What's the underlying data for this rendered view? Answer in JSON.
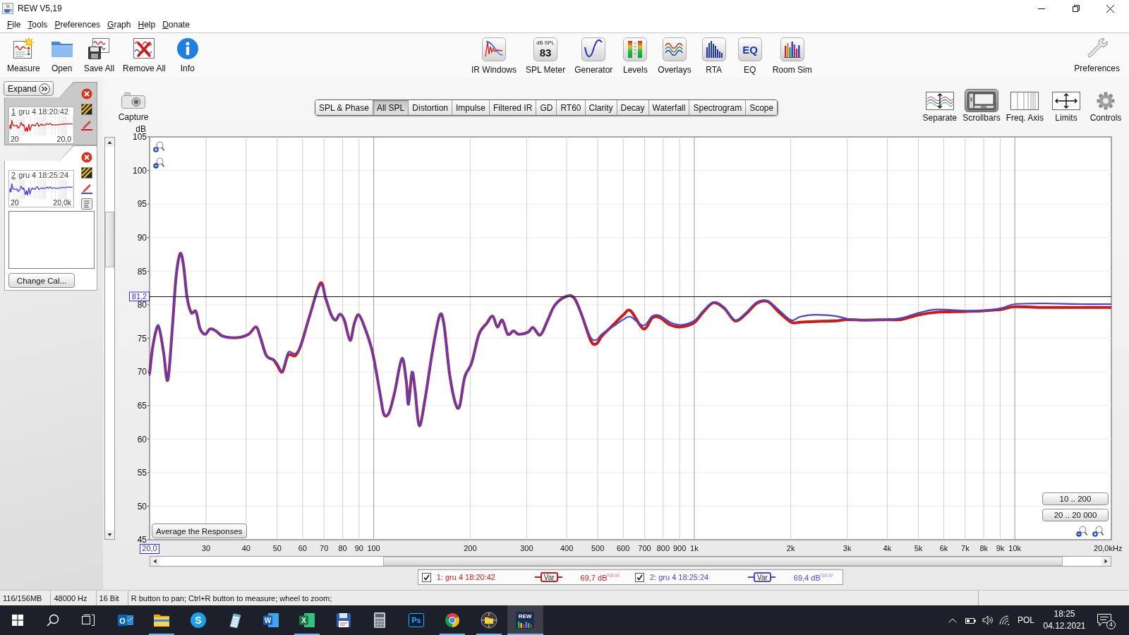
{
  "window": {
    "title": "REW V5,19"
  },
  "menu": [
    "File",
    "Tools",
    "Preferences",
    "Graph",
    "Help",
    "Donate"
  ],
  "toolbar": {
    "left": [
      {
        "kind": "measure",
        "label": "Measure"
      },
      {
        "kind": "open",
        "label": "Open"
      },
      {
        "kind": "saveall",
        "label": "Save All"
      },
      {
        "kind": "removeall",
        "label": "Remove All"
      },
      {
        "kind": "info",
        "label": "Info"
      }
    ],
    "center": [
      {
        "kind": "irwindows",
        "label": "IR Windows"
      },
      {
        "kind": "meter",
        "label": "SPL Meter",
        "icon_unit": "dB SPL",
        "icon_value": "83"
      },
      {
        "kind": "generator",
        "label": "Generator"
      },
      {
        "kind": "levels",
        "label": "Levels"
      },
      {
        "kind": "overlays",
        "label": "Overlays"
      },
      {
        "kind": "rta",
        "label": "RTA"
      },
      {
        "kind": "eq",
        "label": "EQ",
        "icon_text": "EQ"
      },
      {
        "kind": "roomsim",
        "label": "Room Sim"
      }
    ],
    "right": [
      {
        "kind": "preferences",
        "label": "Preferences"
      }
    ]
  },
  "side_panel": {
    "expand_label": "Expand",
    "measurements": [
      {
        "number": "1",
        "name": "gru 4 18:20:42",
        "axis_start": "20",
        "axis_end": "20,0",
        "color": "#cc2020",
        "selected": false
      },
      {
        "number": "2",
        "name": "gru 4 18:25:24",
        "axis_start": "20",
        "axis_end": "20,0k",
        "color": "#4848d8",
        "selected": true
      }
    ],
    "change_cal_label": "Change Cal..."
  },
  "capture_label": "Capture",
  "graph_tabs": [
    {
      "label": "SPL & Phase",
      "selected": false
    },
    {
      "label": "All SPL",
      "selected": true
    },
    {
      "label": "Distortion",
      "selected": false
    },
    {
      "label": "Impulse",
      "selected": false
    },
    {
      "label": "Filtered IR",
      "selected": false
    },
    {
      "label": "GD",
      "selected": false
    },
    {
      "label": "RT60",
      "selected": false
    },
    {
      "label": "Clarity",
      "selected": false
    },
    {
      "label": "Decay",
      "selected": false
    },
    {
      "label": "Waterfall",
      "selected": false
    },
    {
      "label": "Spectrogram",
      "selected": false
    },
    {
      "label": "Scope",
      "selected": false
    }
  ],
  "view_buttons": [
    {
      "kind": "separate",
      "label": "Separate",
      "selected": false
    },
    {
      "kind": "scrollbars",
      "label": "Scrollbars",
      "selected": true
    },
    {
      "kind": "freqaxis",
      "label": "Freq. Axis",
      "selected": false
    },
    {
      "kind": "limits",
      "label": "Limits",
      "selected": false
    },
    {
      "kind": "controls",
      "label": "Controls",
      "selected": false
    }
  ],
  "graph": {
    "chart_data": {
      "type": "line",
      "xlabel": "Hz",
      "ylabel": "dB",
      "log": "x",
      "grid": true,
      "x": [
        20,
        20.5,
        21.3,
        22.1,
        22.8,
        23.6,
        24.2,
        24.9,
        25.5,
        26.2,
        27,
        27.9,
        28.7,
        29.8,
        30.9,
        32.2,
        33.9,
        37.6,
        40.7,
        43,
        44.4,
        46.3,
        48.7,
        50,
        51.9,
        54.1,
        56.9,
        59.3,
        63.1,
        68.2,
        70.8,
        73.7,
        76.1,
        78.5,
        81,
        84.4,
        87,
        89.8,
        93.6,
        98.6,
        101.7,
        104.9,
        107.6,
        111.6,
        116.3,
        122.5,
        126.4,
        128.4,
        131.7,
        134.5,
        138.7,
        144.6,
        152.3,
        160.4,
        165.5,
        172.5,
        179.7,
        185.4,
        192.2,
        202,
        213,
        225,
        235,
        243,
        252,
        262,
        273,
        283,
        303,
        314,
        331,
        349,
        367,
        397,
        422,
        447,
        476,
        496,
        514,
        556,
        601,
        633,
        694,
        739,
        778,
        841,
        909,
        998,
        1062,
        1147,
        1240,
        1340,
        1448,
        1566,
        1692,
        1828,
        2007,
        2136,
        2369,
        2767,
        3006,
        3404,
        3996,
        4410,
        5018,
        5712,
        7028,
        7998,
        9102,
        9991,
        12426,
        16092,
        20000
      ],
      "series": [
        {
          "color": "#cc1a1a",
          "values": [
            69.7,
            74.0,
            76.8,
            73.0,
            68.8,
            77.2,
            84.2,
            87.6,
            86.0,
            81.0,
            78.8,
            79.0,
            76.5,
            75.6,
            76.4,
            76.1,
            75.3,
            75.1,
            75.6,
            76.7,
            75.0,
            72.4,
            71.8,
            71.0,
            70.0,
            72.5,
            72.4,
            74.0,
            78.3,
            83.2,
            81.0,
            78.5,
            77.7,
            78.6,
            77.7,
            74.7,
            77.2,
            78.5,
            76.7,
            73.4,
            70.2,
            66.5,
            63.7,
            63.9,
            67.0,
            72.0,
            68.6,
            65.2,
            69.9,
            67.5,
            62.0,
            65.9,
            72.9,
            78.3,
            77.2,
            69.7,
            65.4,
            64.9,
            69.2,
            71.3,
            75.6,
            77.2,
            78.3,
            76.7,
            77.7,
            75.6,
            76.1,
            75.6,
            75.9,
            76.6,
            75.5,
            77.7,
            79.9,
            81.2,
            81.0,
            78.3,
            74.6,
            74.2,
            75.3,
            76.9,
            78.5,
            79.1,
            76.4,
            78.0,
            78.1,
            77.0,
            76.7,
            77.3,
            78.8,
            80.3,
            79.5,
            77.6,
            78.6,
            80.2,
            80.5,
            79.0,
            77.4,
            77.4,
            77.5,
            77.6,
            77.8,
            77.7,
            77.8,
            77.8,
            78.5,
            78.9,
            79.0,
            79.1,
            79.3,
            79.7,
            79.6,
            79.6,
            79.6
          ]
        },
        {
          "color": "#4646d6",
          "values": [
            69.4,
            74.0,
            77.0,
            73.0,
            68.9,
            77.2,
            84.2,
            87.6,
            86.0,
            81.0,
            78.8,
            79.0,
            76.5,
            75.6,
            76.4,
            76.1,
            75.3,
            75.1,
            75.6,
            76.7,
            75.0,
            72.4,
            71.8,
            71.3,
            70.2,
            72.9,
            72.7,
            74.0,
            78.3,
            82.9,
            81.0,
            78.5,
            77.7,
            78.6,
            77.7,
            74.7,
            77.2,
            78.5,
            76.7,
            73.4,
            70.2,
            66.5,
            63.7,
            63.9,
            67.0,
            72.0,
            68.6,
            65.2,
            69.9,
            67.5,
            62.0,
            65.9,
            72.9,
            78.3,
            77.2,
            69.7,
            65.4,
            64.9,
            69.2,
            71.3,
            75.6,
            77.2,
            78.3,
            76.7,
            77.7,
            75.6,
            76.1,
            75.6,
            75.9,
            76.6,
            75.5,
            77.7,
            79.9,
            81.2,
            81.0,
            78.3,
            75.1,
            74.8,
            75.6,
            76.7,
            77.8,
            78.2,
            76.9,
            78.3,
            78.4,
            77.4,
            77.0,
            77.6,
            79.0,
            80.4,
            79.6,
            77.7,
            78.8,
            80.4,
            80.6,
            79.3,
            77.7,
            78.2,
            78.5,
            78.3,
            77.9,
            77.7,
            77.8,
            78.0,
            78.8,
            79.3,
            79.1,
            79.1,
            79.5,
            80.1,
            80.2,
            80.1,
            80.1
          ]
        }
      ],
      "xlim": [
        20,
        20000
      ],
      "ylim": [
        45,
        105
      ],
      "xticks": [
        {
          "value": 20,
          "label": "20,0"
        },
        {
          "value": 30,
          "label": "30"
        },
        {
          "value": 40,
          "label": "40"
        },
        {
          "value": 50,
          "label": "50"
        },
        {
          "value": 60,
          "label": "60"
        },
        {
          "value": 70,
          "label": "70"
        },
        {
          "value": 80,
          "label": "80"
        },
        {
          "value": 90,
          "label": "90"
        },
        {
          "value": 100,
          "label": "100"
        },
        {
          "value": 200,
          "label": "200"
        },
        {
          "value": 300,
          "label": "300"
        },
        {
          "value": 400,
          "label": "400"
        },
        {
          "value": 500,
          "label": "500"
        },
        {
          "value": 600,
          "label": "600"
        },
        {
          "value": 700,
          "label": "700"
        },
        {
          "value": 800,
          "label": "800"
        },
        {
          "value": 900,
          "label": "900"
        },
        {
          "value": 1000,
          "label": "1k"
        },
        {
          "value": 2000,
          "label": "2k"
        },
        {
          "value": 3000,
          "label": "3k"
        },
        {
          "value": 4000,
          "label": "4k"
        },
        {
          "value": 5000,
          "label": "5k"
        },
        {
          "value": 6000,
          "label": "6k"
        },
        {
          "value": 7000,
          "label": "7k"
        },
        {
          "value": 8000,
          "label": "8k"
        },
        {
          "value": 9000,
          "label": "9k"
        },
        {
          "value": 10000,
          "label": "10k"
        },
        {
          "value": 20000,
          "label": "20,0k"
        }
      ],
      "yticks": [
        45,
        50,
        55,
        60,
        65,
        70,
        75,
        80,
        85,
        90,
        95,
        100,
        105
      ],
      "ref_lines": [
        {
          "axis": "y",
          "value": 81.2,
          "label": "81,2"
        }
      ]
    },
    "average_button": "Average the Responses",
    "range_buttons": [
      "10 .. 200",
      "20 .. 20 000"
    ]
  },
  "legend": [
    {
      "checked": true,
      "name": "1: gru 4 18:20:42",
      "badge": "Var",
      "reading": "69,7 dB$^{NEW}$",
      "color": "#cc1a1a"
    },
    {
      "checked": true,
      "name": "2: gru 4 18:25:24",
      "badge": "Var",
      "reading": "69,4 dB$^{NEW}$",
      "color": "#4a4ad8"
    }
  ],
  "status_bar": [
    "116/156MB",
    "48000 Hz",
    "16 Bit",
    "R button to pan; Ctrl+R button to measure; wheel to zoom;"
  ],
  "taskbar": {
    "apps": [
      {
        "kind": "mail",
        "glyph": "O",
        "selected": false,
        "running": false
      },
      {
        "kind": "folder",
        "selected": false,
        "running": true
      },
      {
        "kind": "chat",
        "glyph": "S",
        "selected": false,
        "running": false
      },
      {
        "kind": "notepad",
        "selected": false,
        "running": false
      },
      {
        "kind": "document",
        "glyph": "W",
        "selected": false,
        "running": false
      },
      {
        "kind": "sheet",
        "glyph": "X",
        "selected": false,
        "running": true
      },
      {
        "kind": "disk",
        "selected": false,
        "running": false
      },
      {
        "kind": "calculator",
        "selected": false,
        "running": false
      },
      {
        "kind": "image",
        "glyph": "Ps",
        "selected": false,
        "running": false
      },
      {
        "kind": "browser",
        "selected": false,
        "running": true
      },
      {
        "kind": "target",
        "selected": false,
        "running": true
      },
      {
        "kind": "audio",
        "glyph": "REW",
        "selected": true,
        "running": true
      }
    ],
    "tray": {
      "language": "POL",
      "time": "18:25",
      "date": "04.12.2021",
      "notifications": "4"
    }
  }
}
